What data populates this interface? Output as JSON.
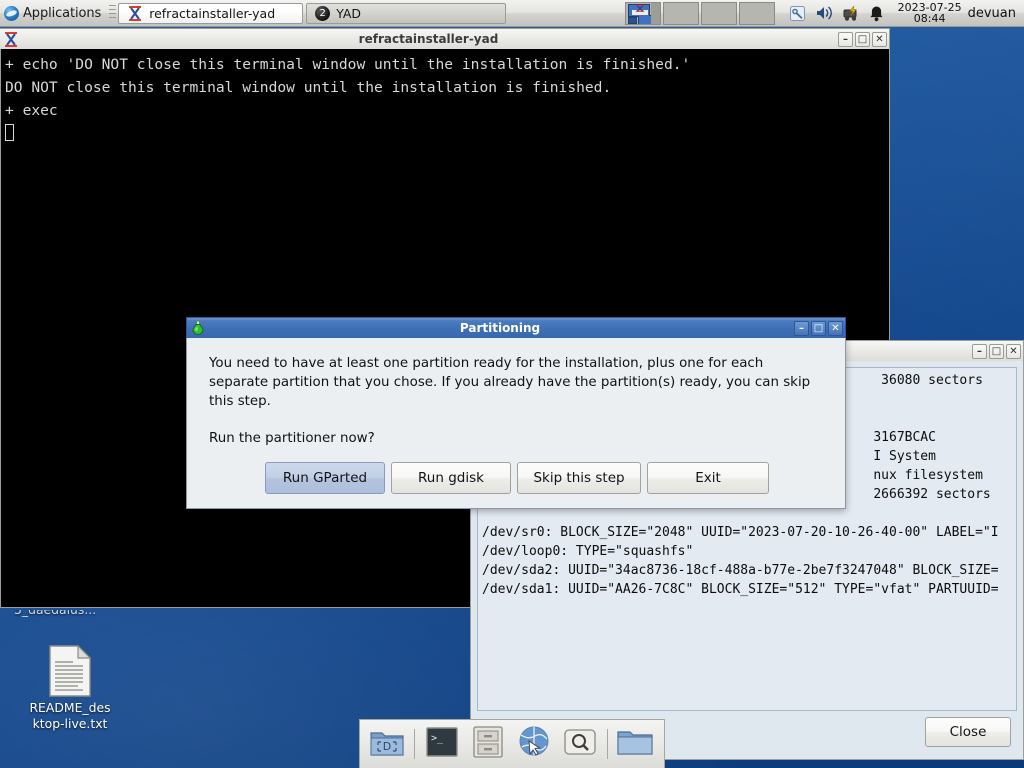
{
  "top_panel": {
    "applications_label": "Applications",
    "apps_icon": "globe-icon",
    "menu_grip_icon": "menu-grip-icon",
    "tasks": [
      {
        "label": "refractainstaller-yad",
        "icon": "xterm-icon",
        "active": true
      },
      {
        "label": "YAD",
        "icon": "yad-badge-icon",
        "badge": "2",
        "active": false
      }
    ],
    "pager_icon": "workspace-pager-icon",
    "tray_icons": [
      "screwdriver-icon",
      "volume-icon",
      "update-icon",
      "bell-icon"
    ],
    "clock_date": "2023-07-25",
    "clock_time": "08:44",
    "user_name": "devuan"
  },
  "terminal_window": {
    "title": "refractainstaller-yad",
    "icon": "xterm-icon",
    "minimize_label": "–",
    "maximize_label": "□",
    "close_label": "✕",
    "lines": [
      "+ echo 'DO NOT close this terminal window until the installation is finished.'",
      "DO NOT close this terminal window until the installation is finished.",
      "+ exec"
    ]
  },
  "partinfo_window": {
    "minimize_label": "–",
    "maximize_label": "□",
    "close_label": "✕",
    "text_lines": [
      "                                                   36080 sectors",
      "",
      "",
      "                                                  3167BCAC",
      "                                                  I System",
      "                                                  nux filesystem",
      "                                                  2666392 sectors",
      "",
      "/dev/sr0: BLOCK_SIZE=\"2048\" UUID=\"2023-07-20-10-26-40-00\" LABEL=\"I",
      "/dev/loop0: TYPE=\"squashfs\"",
      "/dev/sda2: UUID=\"34ac8736-18cf-488a-b77e-2be7f3247048\" BLOCK_SIZE=",
      "/dev/sda1: UUID=\"AA26-7C8C\" BLOCK_SIZE=\"512\" TYPE=\"vfat\" PARTUUID="
    ],
    "close_button_label": "Close"
  },
  "partitioning_dialog": {
    "title": "Partitioning",
    "icon": "green-flask-icon",
    "minimize_label": "–",
    "maximize_label": "□",
    "close_label": "✕",
    "body_paragraph": "You need to have at least one partition ready for the installation, plus one for each separate partition that you chose. If you already have the partition(s) ready, you can skip this step.",
    "question": "Run the partitioner now?",
    "buttons": [
      {
        "label": "Run GParted",
        "primary": true
      },
      {
        "label": "Run gdisk",
        "primary": false
      },
      {
        "label": "Skip this step",
        "primary": false
      },
      {
        "label": "Exit",
        "primary": false
      }
    ]
  },
  "desktop": {
    "clipped_icon_label": "5_daedalus...",
    "readme_icon": "text-file-icon",
    "readme_label_line1": "README_des",
    "readme_label_line2": "ktop-live.txt"
  },
  "dock": {
    "items": [
      {
        "icon": "devuan-folder-icon",
        "name": "devuan-folder"
      },
      {
        "icon": "terminal-icon",
        "name": "terminal"
      },
      {
        "icon": "file-cabinet-icon",
        "name": "file-manager"
      },
      {
        "icon": "web-browser-icon",
        "name": "web-browser"
      },
      {
        "icon": "magnifier-icon",
        "name": "search"
      },
      {
        "icon": "folder-icon",
        "name": "folder"
      }
    ]
  },
  "colors": {
    "desktop_blue": "#17519a",
    "active_title": "#3f6fb5",
    "dialog_bg": "#eceff2",
    "primary_button": "#c1cfe6",
    "terminal_bg": "#000000"
  }
}
